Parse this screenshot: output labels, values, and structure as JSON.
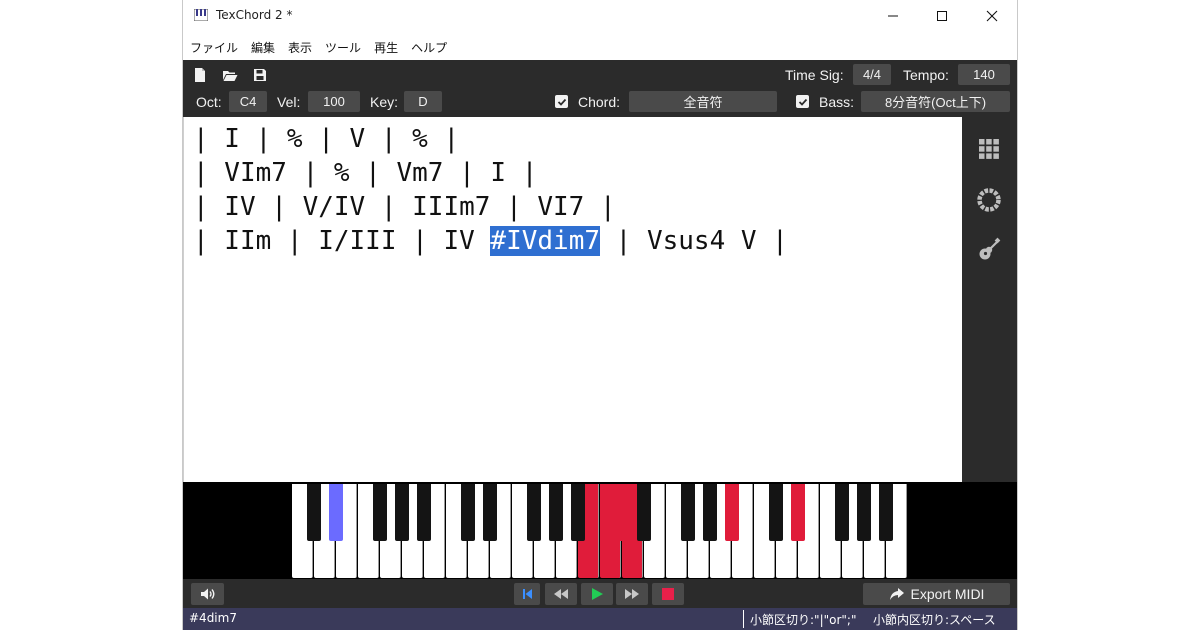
{
  "window": {
    "title": "TexChord 2 *"
  },
  "menu": {
    "items": [
      "ファイル",
      "編集",
      "表示",
      "ツール",
      "再生",
      "ヘルプ"
    ]
  },
  "toolbar": {
    "time_sig_label": "Time Sig:",
    "time_sig_value": "4/4",
    "tempo_label": "Tempo:",
    "tempo_value": "140",
    "oct_label": "Oct:",
    "oct_value": "C4",
    "vel_label": "Vel:",
    "vel_value": "100",
    "key_label": "Key:",
    "key_value": "D",
    "chord_label": "Chord:",
    "chord_checked": true,
    "chord_value": "全音符",
    "bass_label": "Bass:",
    "bass_checked": true,
    "bass_value": "8分音符(Oct上下)"
  },
  "editor": {
    "lines": [
      {
        "text": "| I | % | V | % |"
      },
      {
        "text": "| VIm7 | % | Vm7 | I |"
      },
      {
        "text": "| IV | V/IV | IIIm7 | VI7 |"
      },
      {
        "before": "| IIm | I/III | IV ",
        "selected": "#IVdim7",
        "after": " | Vsus4 V |"
      }
    ]
  },
  "side_panel": {
    "icons": [
      "grid-icon",
      "circle-of-fifths-icon",
      "guitar-icon"
    ]
  },
  "piano": {
    "highlight_color": "#e01c3a",
    "cursor_color": "#6b6bff"
  },
  "transport": {
    "export_label": "Export MIDI"
  },
  "status": {
    "current_chord": "#4dim7",
    "hint_measure": "小節区切り:\"|\"or\";\"",
    "hint_inner": "小節内区切り:スペース"
  }
}
